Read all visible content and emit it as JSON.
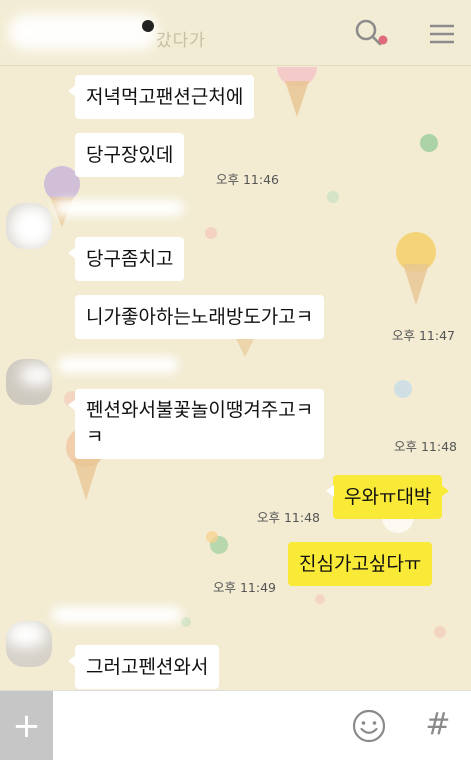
{
  "header": {
    "title_partial": "갔다가",
    "search_icon": "search-icon",
    "menu_icon": "hamburger-menu-icon",
    "colors": {
      "background": "#f2ecd4",
      "icon": "#8c8c8c",
      "icon_accent": "#e06a7a"
    }
  },
  "messages": [
    {
      "sender": "other",
      "text": "저녁먹고팬션근처에",
      "time": ""
    },
    {
      "sender": "other",
      "text": "당구장있데",
      "time": "오후 11:46"
    },
    {
      "sender": "other",
      "text": "당구좀치고",
      "time": ""
    },
    {
      "sender": "other",
      "text": "니가좋아하는노래방도가고ㅋ",
      "time": "오후 11:47"
    },
    {
      "sender": "other",
      "text": "펜션와서불꽃놀이땡겨주고ㅋ",
      "text_line2": "ㅋ",
      "time": "오후 11:48"
    },
    {
      "sender": "me",
      "text": "우와ㅠ대박",
      "time": "오후 11:48"
    },
    {
      "sender": "me",
      "text": "진심가고싶다ㅠ",
      "time": "오후 11:49"
    },
    {
      "sender": "other",
      "text": "그러고펜션와서",
      "time": ""
    }
  ],
  "input_bar": {
    "plus_label": "+",
    "message_value": "",
    "emoji_icon": "smiley-icon",
    "hash_label": "#"
  },
  "colors": {
    "wallpaper": "#f3ecd3",
    "bubble_other": "#ffffff",
    "bubble_me": "#f9ea38",
    "time_text": "#555555"
  }
}
